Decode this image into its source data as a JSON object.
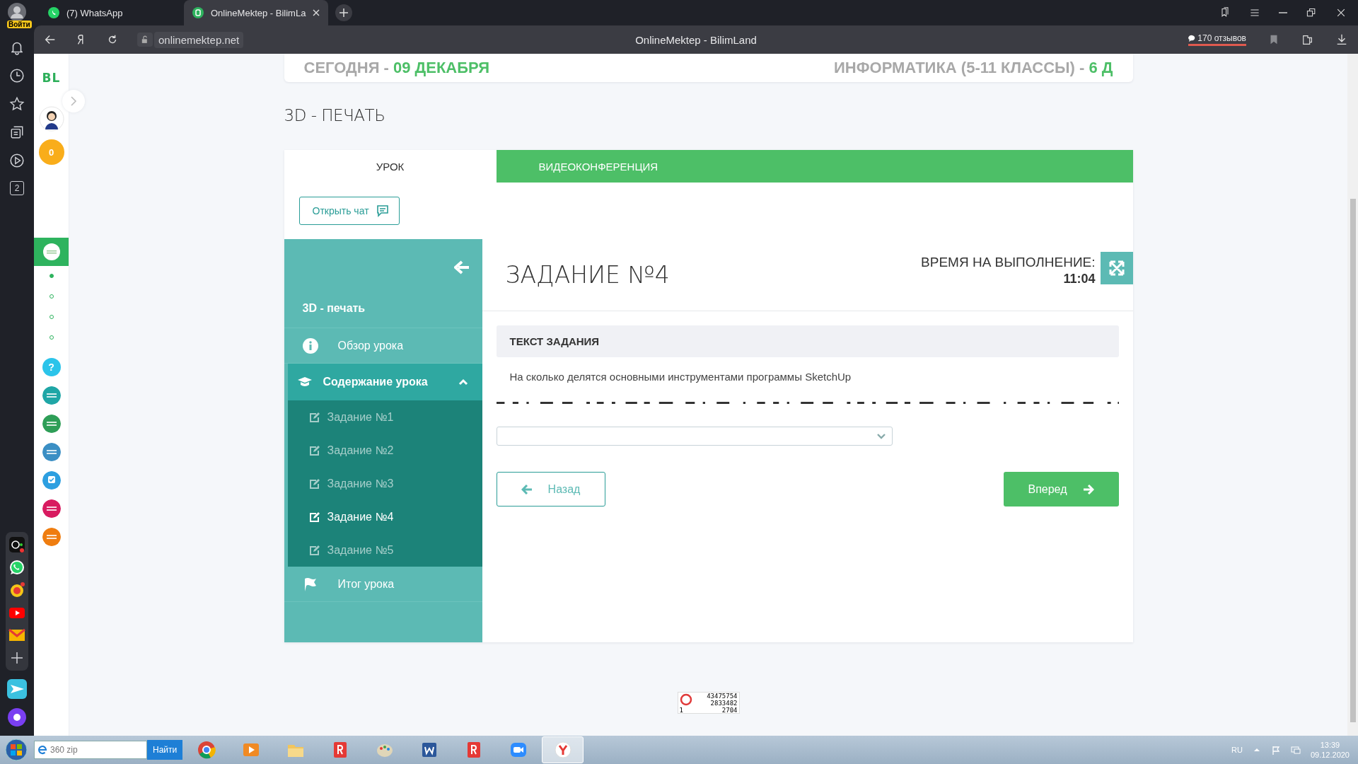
{
  "browser": {
    "profile_badge": "Войти",
    "tabs": [
      {
        "kind": "whatsapp",
        "label": "(7) WhatsApp",
        "selected": false
      },
      {
        "kind": "site",
        "label": "OnlineMektep - BilimLa",
        "selected": true
      }
    ],
    "address": "onlinemektep.net",
    "page_title": "OnlineMektep - BilimLand",
    "reviews": "170 отзывов"
  },
  "browser_sidebar": {
    "tab_count": "2"
  },
  "site_sidebar": {
    "logo": "BL",
    "coins": "0",
    "dots": [
      {
        "selected": true
      },
      {
        "selected": false
      },
      {
        "selected": false
      },
      {
        "selected": false
      }
    ],
    "apps": [
      {
        "kind": "help",
        "label": "?",
        "color": "#2bc4ea"
      },
      {
        "kind": "logo",
        "color": "#1fa6a6"
      },
      {
        "kind": "logo",
        "color": "#2e9e57"
      },
      {
        "kind": "logo",
        "color": "#3b8fc4"
      },
      {
        "kind": "check",
        "color": "#2d9fe0"
      },
      {
        "kind": "logo",
        "color": "#d81b60"
      },
      {
        "kind": "logo",
        "color": "#ef7d10"
      }
    ]
  },
  "header": {
    "date_label": "СЕГОДНЯ - ",
    "date": "09 ДЕКАБРЯ",
    "subject": "ИНФОРМАТИКА (5-11 КЛАССЫ) - ",
    "grade": "6 Д"
  },
  "lesson": {
    "title": "3D - ПЕЧАТЬ",
    "tabs": [
      {
        "label": "УРОК",
        "selected": true
      },
      {
        "label": "ВИДЕОКОНФЕРЕНЦИЯ",
        "selected": false
      }
    ],
    "chat_button": "Открыть чат",
    "menu": {
      "title": "3D - печать",
      "items": [
        {
          "kind": "info",
          "label": "Обзор урока"
        },
        {
          "kind": "contents",
          "label": "Содержание урока",
          "expanded": true,
          "children": [
            {
              "label": "Задание №1",
              "selected": false
            },
            {
              "label": "Задание №2",
              "selected": false
            },
            {
              "label": "Задание №3",
              "selected": false
            },
            {
              "label": "Задание №4",
              "selected": true
            },
            {
              "label": "Задание №5",
              "selected": false
            }
          ]
        },
        {
          "kind": "summary",
          "label": "Итог урока"
        }
      ]
    },
    "task": {
      "title": "ЗАДАНИЕ №4",
      "time_label": "ВРЕМЯ НА ВЫПОЛНЕНИЕ:",
      "time": "11:04",
      "section": "ТЕКСТ ЗАДАНИЯ",
      "question": "На сколько делятся основными инструментами программы SketchUp",
      "back_button": "Назад",
      "next_button": "Вперед"
    }
  },
  "counter": {
    "views": "43475754",
    "visitors": "2833482",
    "online": "1",
    "today": "2704"
  },
  "taskbar": {
    "search_value": "360 zip",
    "search_button": "Найти",
    "apps": [
      {
        "kind": "chrome",
        "selected": false
      },
      {
        "kind": "player",
        "selected": false
      },
      {
        "kind": "folder",
        "selected": false
      },
      {
        "kind": "yandex",
        "selected": false
      },
      {
        "kind": "paint",
        "selected": false
      },
      {
        "kind": "word",
        "selected": false
      },
      {
        "kind": "yandex",
        "selected": false
      },
      {
        "kind": "zoom",
        "selected": false
      },
      {
        "kind": "ybrowser",
        "selected": true
      }
    ],
    "language": "RU",
    "time": "13:39",
    "date": "09.12.2020"
  }
}
